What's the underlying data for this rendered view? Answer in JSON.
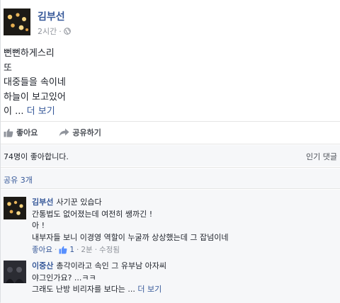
{
  "post": {
    "author": "김부선",
    "time": "2시간",
    "separator": "·",
    "lines": [
      "뻔뻔하게스리",
      "또",
      "대중들을 속이네",
      "하늘이 보고있어"
    ],
    "truncated_line": "이 ...",
    "see_more": "더 보기"
  },
  "actions": {
    "like": "좋아요",
    "share": "공유하기"
  },
  "stats": {
    "likes": "74명이 좋아합니다.",
    "top_comments": "인기 댓글",
    "shares": "공유 3개"
  },
  "comments": [
    {
      "author": "김부선",
      "first": "사기꾼 있습다",
      "lines": [
        "간통법도 없어졌는데 여전히 쌩까긴 !",
        "아 !",
        "내부자들 보니 이경영 역할이 누굴까 상상했는데 그 잡넘이네"
      ],
      "like_label": "좋아요",
      "like_count": "1",
      "time": "2분",
      "edited": "수정됨",
      "dot": "·"
    },
    {
      "author": "이중산",
      "first": "총각이라고 속인 그 유부남 아자씨",
      "lines": [
        "야그인가요? ...ㅋㅋ",
        "그래도 난방 비리자를 보다는 ..."
      ],
      "see_more": "더 보기"
    }
  ],
  "colors": {
    "link": "#365899",
    "meta": "#90949c",
    "strip": "#f6f7f9"
  }
}
